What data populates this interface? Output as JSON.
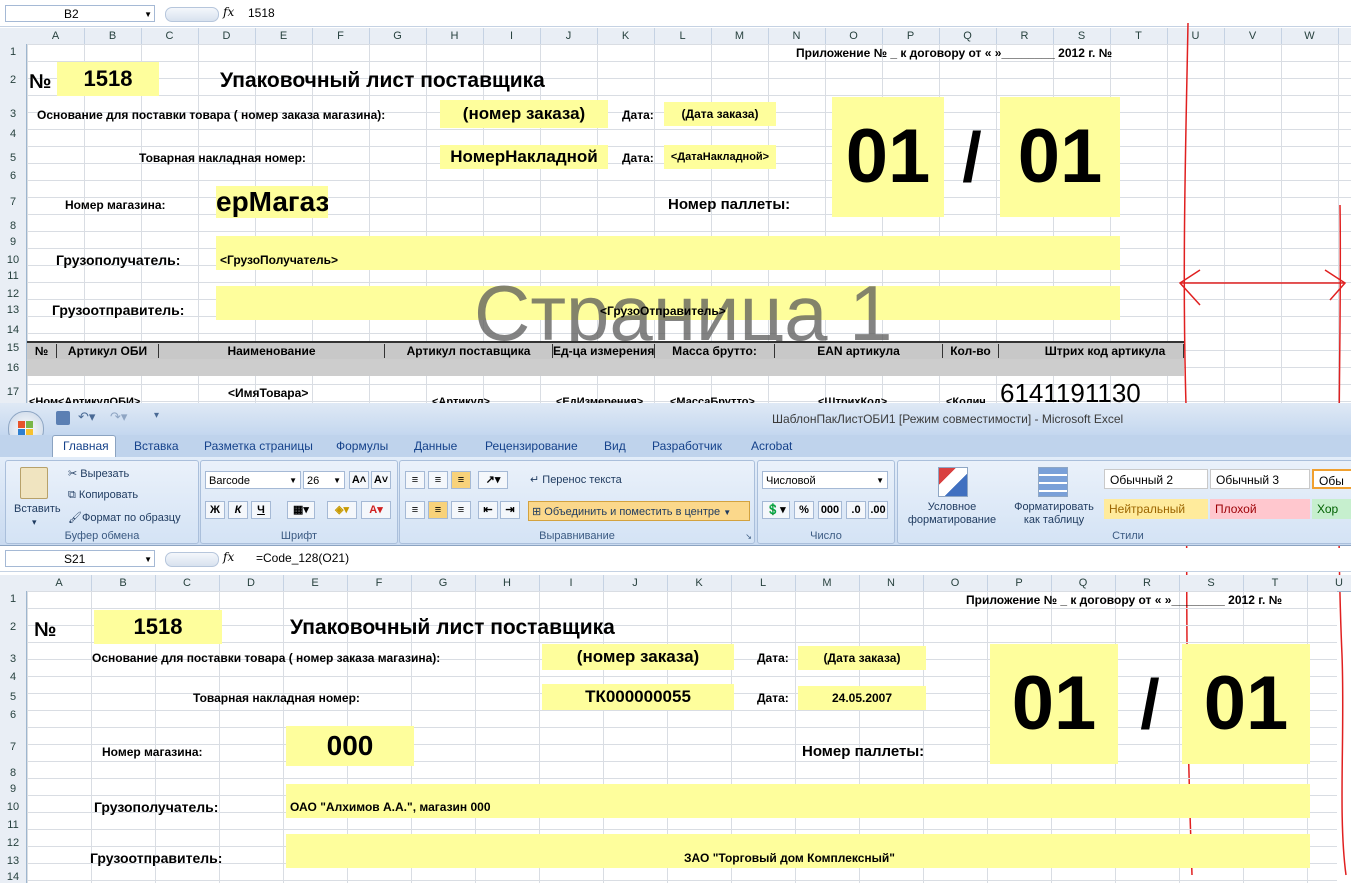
{
  "top": {
    "namebox": "B2",
    "formula": "1518",
    "columns": [
      "A",
      "B",
      "C",
      "D",
      "E",
      "F",
      "G",
      "H",
      "I",
      "J",
      "K",
      "L",
      "M",
      "N",
      "O",
      "P",
      "Q",
      "R",
      "S",
      "T",
      "U",
      "V",
      "W",
      "X"
    ],
    "rows": [
      "1",
      "2",
      "3",
      "4",
      "5",
      "6",
      "7",
      "8",
      "9",
      "10",
      "11",
      "12",
      "13",
      "14",
      "15",
      "16",
      "17"
    ],
    "appendix": "Приложение № _ к договору от «       »________ 2012 г. №",
    "no_label": "№",
    "number": "1518",
    "title": "Упаковочный лист поставщика",
    "basis_label": "Основание для поставки товара ( номер заказа магазина):",
    "order_no": "(номер заказа)",
    "date_label": "Дата:",
    "order_date": "(Дата заказа)",
    "invoice_label": "Товарная накладная номер:",
    "invoice_no": "НомерНакладной",
    "invoice_date": "<ДатаНакладной>",
    "store_label": "Номер магазина:",
    "store_no": "ерМагаз",
    "pallet_label": "Номер паллеты:",
    "pallet_a": "01",
    "pallet_slash": "/",
    "pallet_b": "01",
    "consignee_label": "Грузополучатель:",
    "consignee": "<ГрузоПолучатель>",
    "shipper_label": "Грузоотправитель:",
    "shipper": "<ГрузоОтправитель>",
    "watermark": "Страница 1",
    "table_headers": [
      "№",
      "Артикул ОБИ",
      "Наименование",
      "Артикул поставщика",
      "Ед-ца измерения",
      "Масса брутто:",
      "EAN  артикула",
      "Кол-во",
      "Штрих код артикула"
    ],
    "row17": [
      "<Ном",
      "<АртикулОБИ>",
      "<ИмяТовара>",
      "<Артикул>",
      "<ЕдИзмерения>",
      "<МассаБрутто>",
      "<ШтрихКод>",
      "<Колич",
      "6141191130"
    ]
  },
  "window": {
    "title": "ШаблонПакЛистОБИ1  [Режим совместимости] - Microsoft Excel",
    "tabs": [
      "Главная",
      "Вставка",
      "Разметка страницы",
      "Формулы",
      "Данные",
      "Рецензирование",
      "Вид",
      "Разработчик",
      "Acrobat"
    ]
  },
  "ribbon": {
    "paste": "Вставить",
    "cut": "Вырезать",
    "copy": "Копировать",
    "format_painter": "Формат по образцу",
    "clipboard": "Буфер обмена",
    "font_name": "Barcode",
    "font_size": "26",
    "bold": "Ж",
    "italic": "К",
    "underline": "Ч",
    "font_group": "Шрифт",
    "wrap": "Перенос текста",
    "merge": "Объединить и поместить в центре",
    "align_group": "Выравнивание",
    "number_format": "Числовой",
    "number_group": "Число",
    "cond_format": "Условное форматирование",
    "format_table": "Форматировать как таблицу",
    "styles": [
      "Обычный 2",
      "Обычный 3",
      "Обы",
      "Нейтральный",
      "Плохой",
      "Хор"
    ],
    "styles_group": "Стили"
  },
  "bottom": {
    "namebox": "S21",
    "formula": "=Code_128(O21)",
    "columns": [
      "A",
      "B",
      "C",
      "D",
      "E",
      "F",
      "G",
      "H",
      "I",
      "J",
      "K",
      "L",
      "M",
      "N",
      "O",
      "P",
      "Q",
      "R",
      "S",
      "T",
      "U"
    ],
    "rows": [
      "1",
      "2",
      "3",
      "4",
      "5",
      "6",
      "7",
      "8",
      "9",
      "10",
      "11",
      "12",
      "13",
      "14"
    ],
    "appendix": "Приложение № _ к договору от «       »________ 2012 г. №",
    "no_label": "№",
    "number": "1518",
    "title": "Упаковочный лист поставщика",
    "basis_label": "Основание для поставки товара ( номер заказа магазина):",
    "order_no": "(номер заказа)",
    "date_label": "Дата:",
    "order_date": "(Дата заказа)",
    "invoice_label": "Товарная накладная номер:",
    "invoice_no": "ТК000000055",
    "invoice_date": "24.05.2007",
    "store_label": "Номер магазина:",
    "store_no": "000",
    "pallet_label": "Номер паллеты:",
    "pallet_a": "01",
    "pallet_slash": "/",
    "pallet_b": "01",
    "consignee_label": "Грузополучатель:",
    "consignee": "ОАО \"Алхимов А.А.\", магазин 000",
    "shipper_label": "Грузоотправитель:",
    "shipper": "ЗАО \"Торговый дом Комплексный\""
  },
  "colors": {
    "cell_yellow": "#fefe9c",
    "annotation_red": "#e02020",
    "ribbon_blue": "#c9daf0"
  }
}
